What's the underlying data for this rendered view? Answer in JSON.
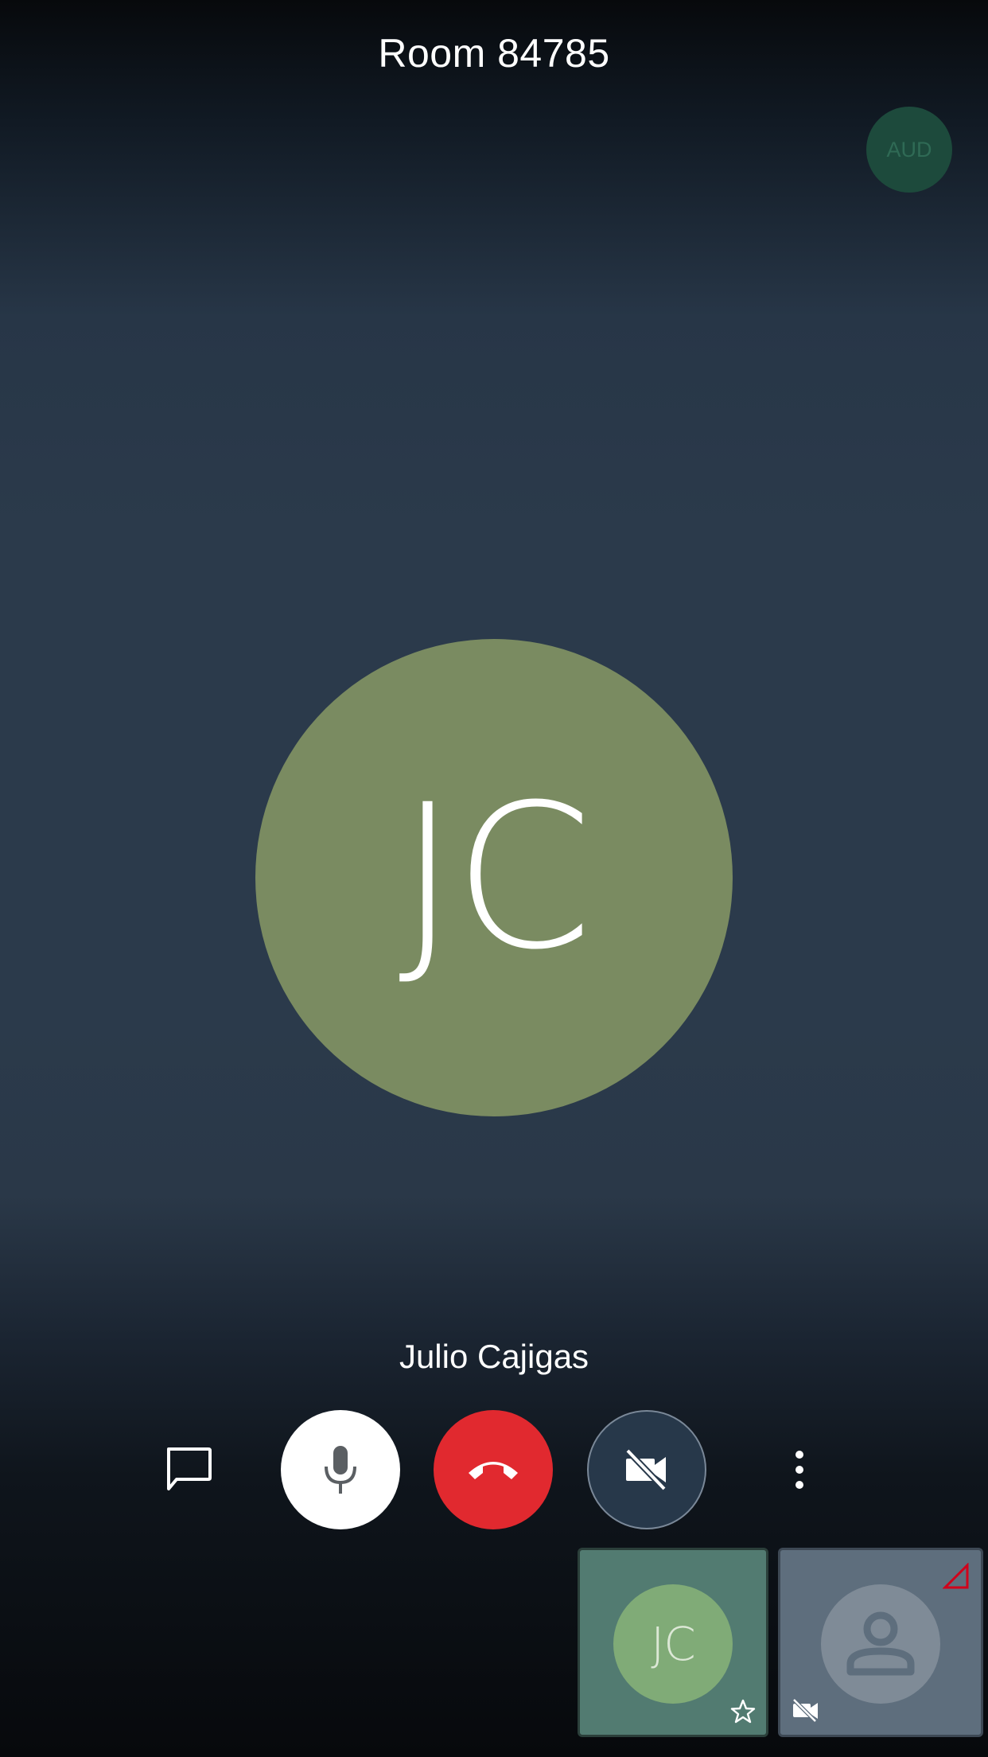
{
  "header": {
    "room_title": "Room 84785"
  },
  "badge": {
    "label": "AUD"
  },
  "main_participant": {
    "initials": "JC",
    "name": "Julio Cajigas",
    "avatar_color": "#7a8b61"
  },
  "controls": [
    {
      "name": "chat",
      "icon": "chat-bubble-icon"
    },
    {
      "name": "microphone",
      "icon": "mic-icon",
      "state": "on"
    },
    {
      "name": "hangup",
      "icon": "phone-hangup-icon",
      "color": "#e1292f"
    },
    {
      "name": "camera",
      "icon": "video-off-icon",
      "state": "off"
    },
    {
      "name": "more",
      "icon": "more-vertical-icon"
    }
  ],
  "thumbnails": {
    "local": {
      "initials": "JC",
      "avatar_color": "#80ab77",
      "icon": "star-icon"
    },
    "remote": {
      "icon": "person-icon",
      "status_icons": [
        "signal-warning-icon",
        "video-off-icon"
      ]
    }
  },
  "colors": {
    "hangup_red": "#e1292f",
    "warning_red": "#d0021b"
  }
}
